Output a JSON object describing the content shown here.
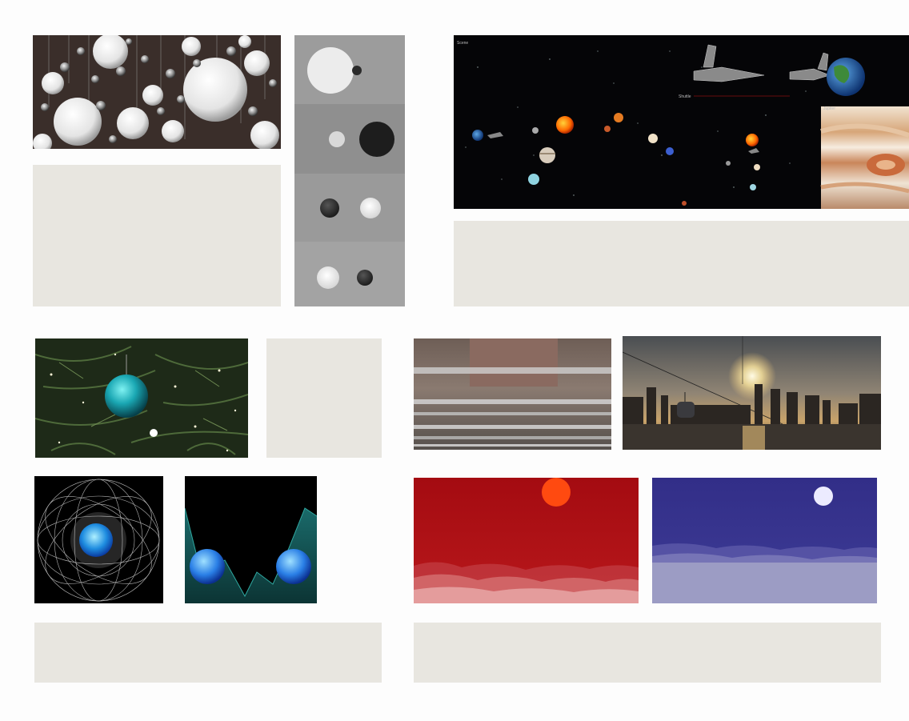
{
  "solar_scene": {
    "label": "Scene",
    "sublabel_a": "Shuttle",
    "sublabel_b": "Jupiter"
  },
  "placeholders": [
    "placeholder-1",
    "placeholder-2",
    "placeholder-3",
    "placeholder-4",
    "placeholder-5"
  ],
  "colors": {
    "placeholder": "#e8e6e0",
    "red_scene_bg": "#a80d12",
    "blue_scene_bg": "#32308a"
  }
}
